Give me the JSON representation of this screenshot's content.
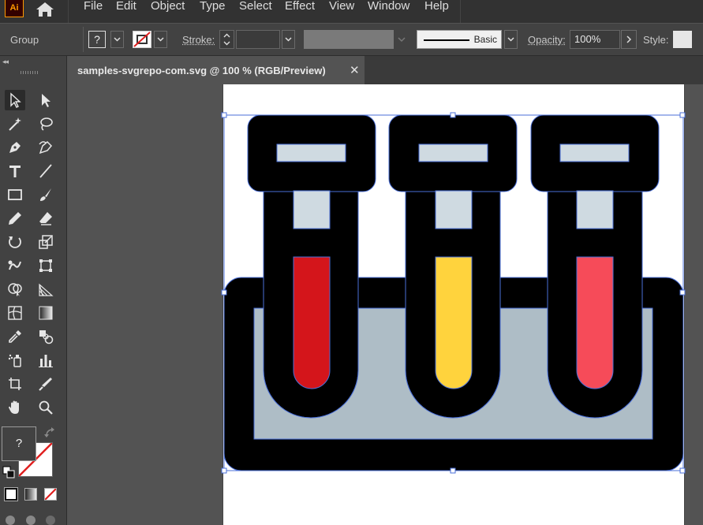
{
  "app": {
    "logo_text": "Ai",
    "accent_color": "#ff9a00"
  },
  "menu": {
    "items": [
      {
        "label": "File"
      },
      {
        "label": "Edit"
      },
      {
        "label": "Object"
      },
      {
        "label": "Type"
      },
      {
        "label": "Select"
      },
      {
        "label": "Effect"
      },
      {
        "label": "View"
      },
      {
        "label": "Window"
      },
      {
        "label": "Help"
      }
    ]
  },
  "control_bar": {
    "selection_label": "Group",
    "fill_value": "?",
    "stroke_label": "Stroke:",
    "brush_label": "Basic",
    "opacity_label": "Opacity:",
    "opacity_value": "100%",
    "style_label": "Style:"
  },
  "tabs": [
    {
      "label": "samples-svgrepo-com.svg @ 100 % (RGB/Preview)",
      "active": true
    }
  ],
  "toolbar": {
    "fill_value": "?",
    "tools": [
      "selection-tool",
      "direct-selection-tool",
      "magic-wand-tool",
      "lasso-tool",
      "pen-tool",
      "curvature-tool",
      "type-tool",
      "line-segment-tool",
      "rectangle-tool",
      "paintbrush-tool",
      "pencil-tool",
      "eraser-tool",
      "rotate-tool",
      "scale-tool",
      "warp-tool",
      "free-transform-tool",
      "shape-builder-tool",
      "perspective-grid-tool",
      "mesh-tool",
      "gradient-tool",
      "eyedropper-tool",
      "blend-tool",
      "symbol-sprayer-tool",
      "column-graph-tool",
      "artboard-tool",
      "slice-tool",
      "hand-tool",
      "zoom-tool"
    ]
  },
  "artwork": {
    "colors": {
      "outline": "#000000",
      "rack_fill": "#aebdc6",
      "cap_fill": "#cfdae1",
      "sample_red": "#d4151b",
      "sample_yellow": "#ffd33d",
      "sample_pink": "#f64b59",
      "selection": "#4a6fd8"
    }
  }
}
